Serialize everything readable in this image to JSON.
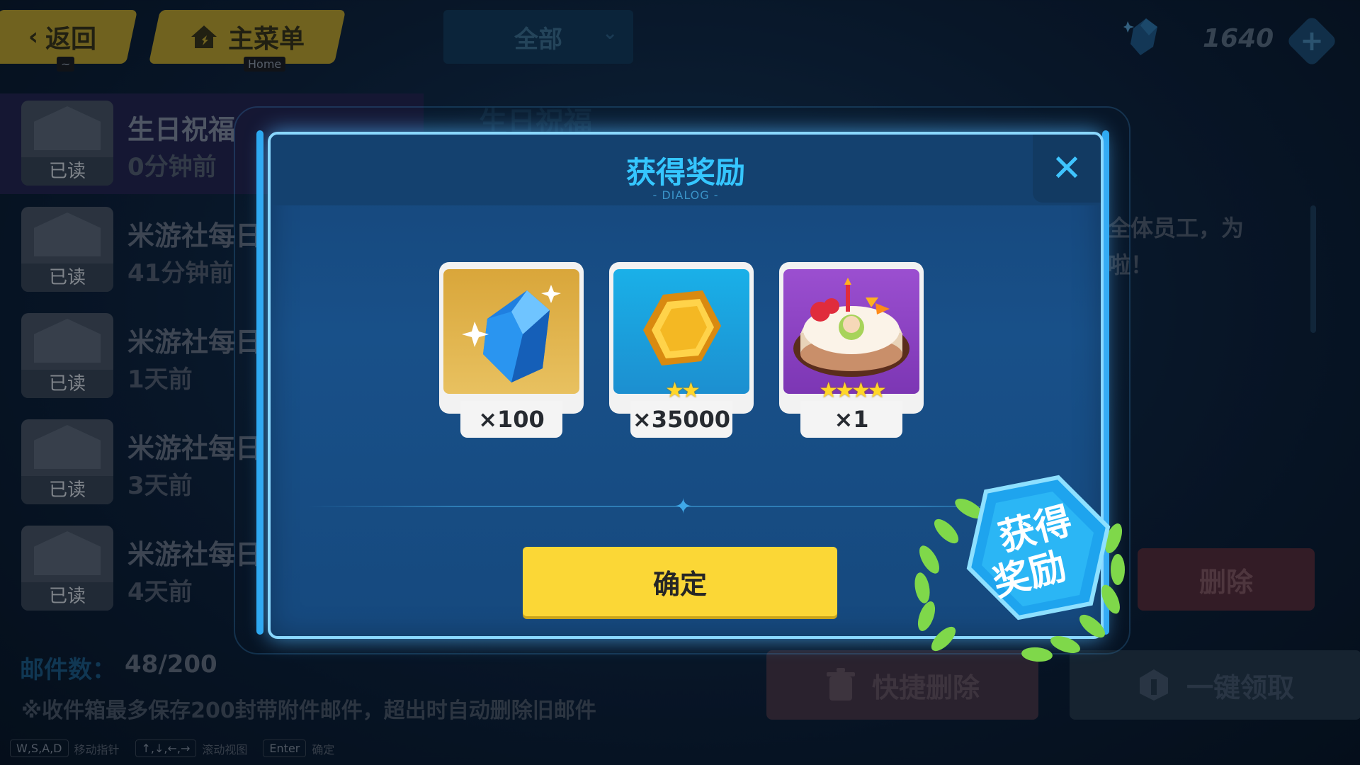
{
  "topbar": {
    "back_label": "返回",
    "back_hint": "~",
    "home_label": "主菜单",
    "home_hint": "Home",
    "filter_label": "全部",
    "currency_value": "1640"
  },
  "mail_list": {
    "items": [
      {
        "title": "生日祝福",
        "time": "0分钟前",
        "status": "已读"
      },
      {
        "title": "米游社每日",
        "time": "41分钟前",
        "status": "已读"
      },
      {
        "title": "米游社每日",
        "time": "1天前",
        "status": "已读"
      },
      {
        "title": "米游社每日",
        "time": "3天前",
        "status": "已读"
      },
      {
        "title": "米游社每日",
        "time": "4天前",
        "status": "已读"
      }
    ],
    "count_label": "邮件数：",
    "count_value": "48/200",
    "note": "※收件箱最多保存200封带附件邮件，超出时自动删除旧邮件"
  },
  "detail": {
    "title": "生日祝福",
    "body_line1": "安全体员工，为",
    "body_line2": "吉啦！",
    "delete_label": "删除",
    "quick_delete_label": "快捷删除",
    "claim_all_label": "一键领取"
  },
  "dialog": {
    "title": "获得奖励",
    "subtitle": "- DIALOG -",
    "rewards": [
      {
        "name": "crystal",
        "quantity": "×100",
        "stars": 0
      },
      {
        "name": "coin",
        "quantity": "×35000",
        "stars": 2
      },
      {
        "name": "birthday-cake",
        "quantity": "×1",
        "stars": 4
      }
    ],
    "confirm_label": "确定",
    "badge_line1": "获得",
    "badge_line2": "奖励"
  },
  "hints": [
    {
      "key": "W,S,A,D",
      "action": "移动指针"
    },
    {
      "key": "↑,↓,←,→",
      "action": "滚动视图"
    },
    {
      "key": "Enter",
      "action": "确定"
    }
  ],
  "colors": {
    "accent_yellow": "#fbd736",
    "dialog_blue": "#185089",
    "title_cyan": "#35c6ff"
  }
}
